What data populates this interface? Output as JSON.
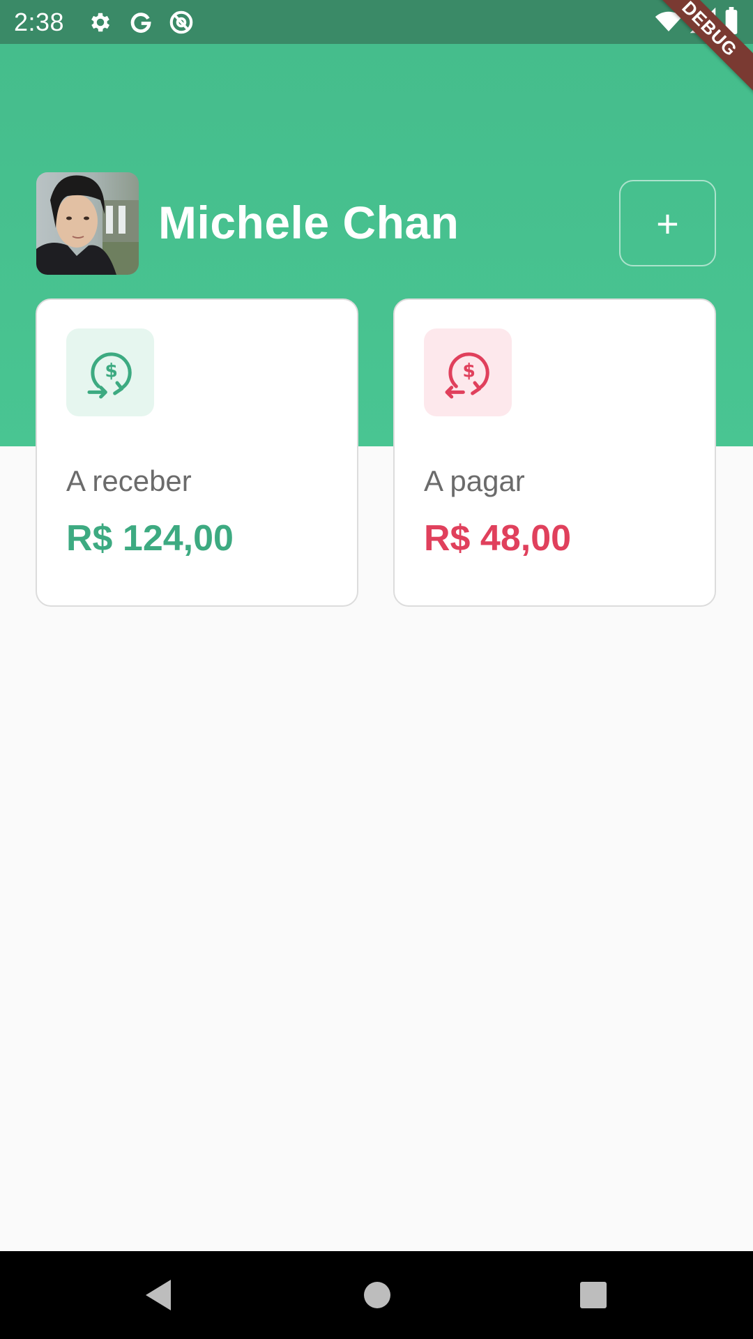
{
  "status_bar": {
    "time": "2:38",
    "left_icons": [
      "settings-icon",
      "google-icon",
      "at-sign-icon"
    ],
    "right_icons": [
      "wifi-icon",
      "cell-signal-icon",
      "battery-icon"
    ],
    "color": "#3a8a67"
  },
  "debug_banner": "DEBUG",
  "header": {
    "user_name": "Michele Chan",
    "add_button_label": "+",
    "background": "#45bd8c"
  },
  "cards": {
    "receive": {
      "label": "A receber",
      "value": "R$ 124,00",
      "icon": "money-receive-icon",
      "accent": "#3daa81"
    },
    "pay": {
      "label": "A pagar",
      "value": "R$ 48,00",
      "icon": "money-pay-icon",
      "accent": "#e0405c"
    }
  },
  "nav_bar": {
    "buttons": [
      "back-button",
      "home-button",
      "recents-button"
    ]
  }
}
